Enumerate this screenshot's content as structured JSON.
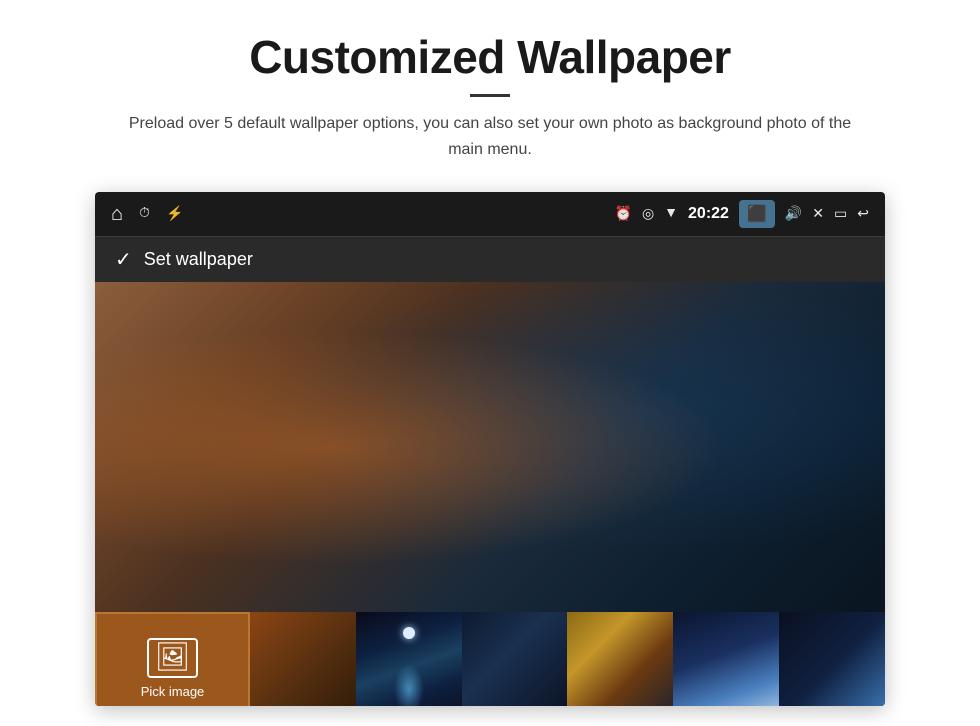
{
  "page": {
    "title": "Customized Wallpaper",
    "subtitle": "Preload over 5 default wallpaper options, you can also set your own photo as background photo of the main menu.",
    "divider": true
  },
  "statusBar": {
    "time": "20:22",
    "icons": {
      "home": "⌂",
      "alarm": "⏰",
      "usb": "⚡",
      "clock": "⏱",
      "location": "📍",
      "wifi": "▼",
      "camera": "📷",
      "volume": "🔊",
      "close": "✕",
      "window": "▭",
      "back": "↩"
    }
  },
  "wallpaperBar": {
    "check": "✓",
    "label": "Set wallpaper"
  },
  "thumbnailStrip": {
    "pickLabel": "Pick image",
    "items": [
      {
        "id": "pick",
        "label": "Pick image"
      },
      {
        "id": "warm-brown"
      },
      {
        "id": "space-aurora"
      },
      {
        "id": "galaxy"
      },
      {
        "id": "sunset-swirl"
      },
      {
        "id": "blue-abstract"
      },
      {
        "id": "deep-space"
      }
    ]
  }
}
